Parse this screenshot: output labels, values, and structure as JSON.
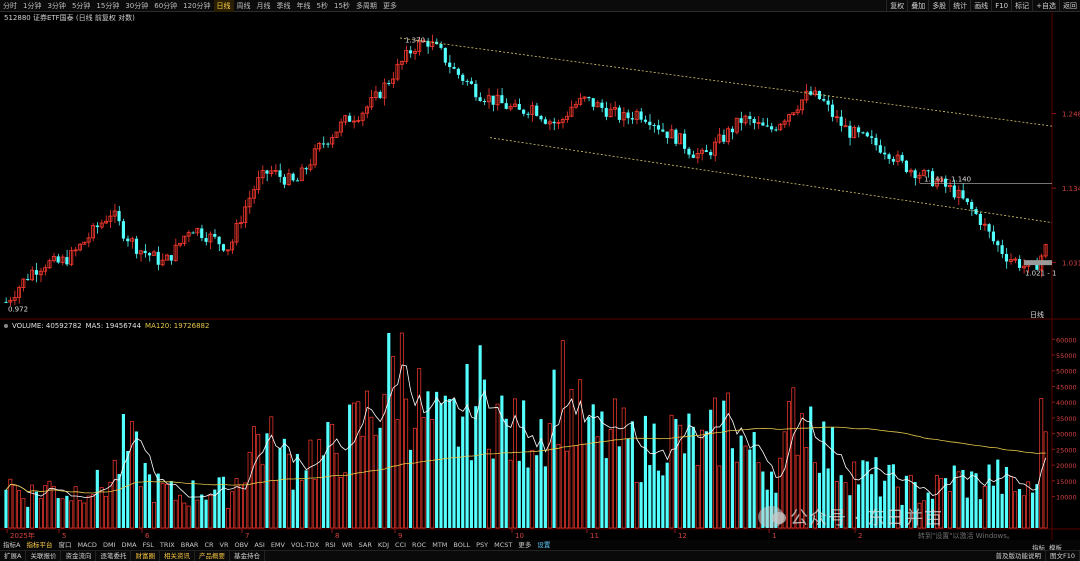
{
  "toolbar": {
    "periods": [
      "分时",
      "1分钟",
      "3分钟",
      "5分钟",
      "15分钟",
      "30分钟",
      "60分钟",
      "120分钟",
      "日线",
      "周线",
      "月线",
      "季线",
      "年线",
      "5秒",
      "15秒",
      "多周期",
      "更多"
    ],
    "active_period": "日线",
    "right_buttons": [
      "复权",
      "叠加",
      "多股",
      "统计",
      "画线",
      "F10",
      "标记",
      "+自选",
      "返回"
    ]
  },
  "title": "512880 证券ETF国泰 (日线 前复权 对数)",
  "chart_data": {
    "type": "candlestick",
    "price_axis_ticks": [
      "1.248",
      "1.134",
      "1.031"
    ],
    "annotations": {
      "high": "1.370",
      "low_left": "0.972",
      "low_right": "1.021 - 1",
      "range_box": "1.141 - 1.140"
    },
    "x_labels": [
      "2025年",
      "5",
      "6",
      "7",
      "8",
      "9",
      "10",
      "11",
      "12",
      "1",
      "2"
    ],
    "volume_ticks": [
      "60000",
      "55000",
      "50000",
      "45000",
      "40000",
      "35000",
      "30000",
      "25000",
      "20000",
      "15000",
      "10000"
    ],
    "close_series_approx": [
      0.98,
      1.0,
      1.02,
      1.03,
      1.03,
      1.04,
      1.06,
      1.08,
      1.1,
      1.07,
      1.05,
      1.04,
      1.03,
      1.05,
      1.08,
      1.07,
      1.06,
      1.05,
      1.1,
      1.14,
      1.16,
      1.15,
      1.14,
      1.17,
      1.2,
      1.22,
      1.24,
      1.25,
      1.27,
      1.3,
      1.33,
      1.36,
      1.37,
      1.35,
      1.32,
      1.3,
      1.28,
      1.27,
      1.26,
      1.25,
      1.26,
      1.24,
      1.23,
      1.26,
      1.27,
      1.26,
      1.25,
      1.24,
      1.25,
      1.24,
      1.22,
      1.21,
      1.19,
      1.18,
      1.2,
      1.22,
      1.24,
      1.23,
      1.22,
      1.24,
      1.26,
      1.28,
      1.27,
      1.24,
      1.22,
      1.21,
      1.2,
      1.19,
      1.17,
      1.16,
      1.15,
      1.14,
      1.13,
      1.11,
      1.09,
      1.06,
      1.04,
      1.03,
      1.02,
      1.05
    ],
    "volume_series_approx": [
      15000,
      12000,
      11000,
      13000,
      12500,
      11000,
      14000,
      13000,
      15000,
      26000,
      22000,
      14000,
      12000,
      10000,
      11000,
      12500,
      12000,
      11000,
      19000,
      30000,
      26000,
      22000,
      21000,
      24000,
      23000,
      25000,
      28000,
      32000,
      38000,
      48000,
      52000,
      41000,
      34000,
      30000,
      33000,
      36000,
      42000,
      40000,
      31000,
      28000,
      33000,
      35000,
      47000,
      38000,
      30000,
      28000,
      29000,
      27000,
      25000,
      26000,
      30000,
      28000,
      27000,
      24000,
      30000,
      36000,
      26000,
      22000,
      19000,
      21000,
      38000,
      37000,
      27000,
      22000,
      19000,
      17000,
      16000,
      15000,
      13000,
      12000,
      11000,
      13000,
      16000,
      15000,
      13500,
      17000,
      14000,
      12000,
      11000,
      40000
    ]
  },
  "volume_info": {
    "volume": "VOLUME: 40592782",
    "ma5": "MA5: 19456744",
    "ma120": "MA120: 19726882"
  },
  "indicators": [
    "指标A",
    "指标平台",
    "窗口",
    "MACD",
    "DMI",
    "DMA",
    "FSL",
    "TRIX",
    "BRAR",
    "CR",
    "VR",
    "OBV",
    "ASI",
    "EMV",
    "VOL-TDX",
    "RSI",
    "WR",
    "SAR",
    "KDJ",
    "CCI",
    "ROC",
    "MTM",
    "BOLL",
    "PSY",
    "MCST",
    "更多",
    "设置"
  ],
  "active_indicator": "指标平台",
  "bottom_tabs": [
    "扩展A",
    "关联报价",
    "资金流向",
    "逐笔委托",
    "财富圈",
    "相关资讯",
    "产品概要",
    "基金持仓"
  ],
  "bottom_right": [
    "普及版功能说明",
    "图文F10"
  ],
  "side_label": "日线",
  "side_buttons": [
    "指标",
    "模板"
  ],
  "watermark": "公众号 · 东日并亩",
  "windows_notice": "转到\"设置\"以激活 Windows。",
  "colors": {
    "up": "#ff3b30",
    "down": "#54ffff",
    "ma120": "#e6c84a",
    "ma5": "#ffffff",
    "trendline": "#d9c86a"
  }
}
